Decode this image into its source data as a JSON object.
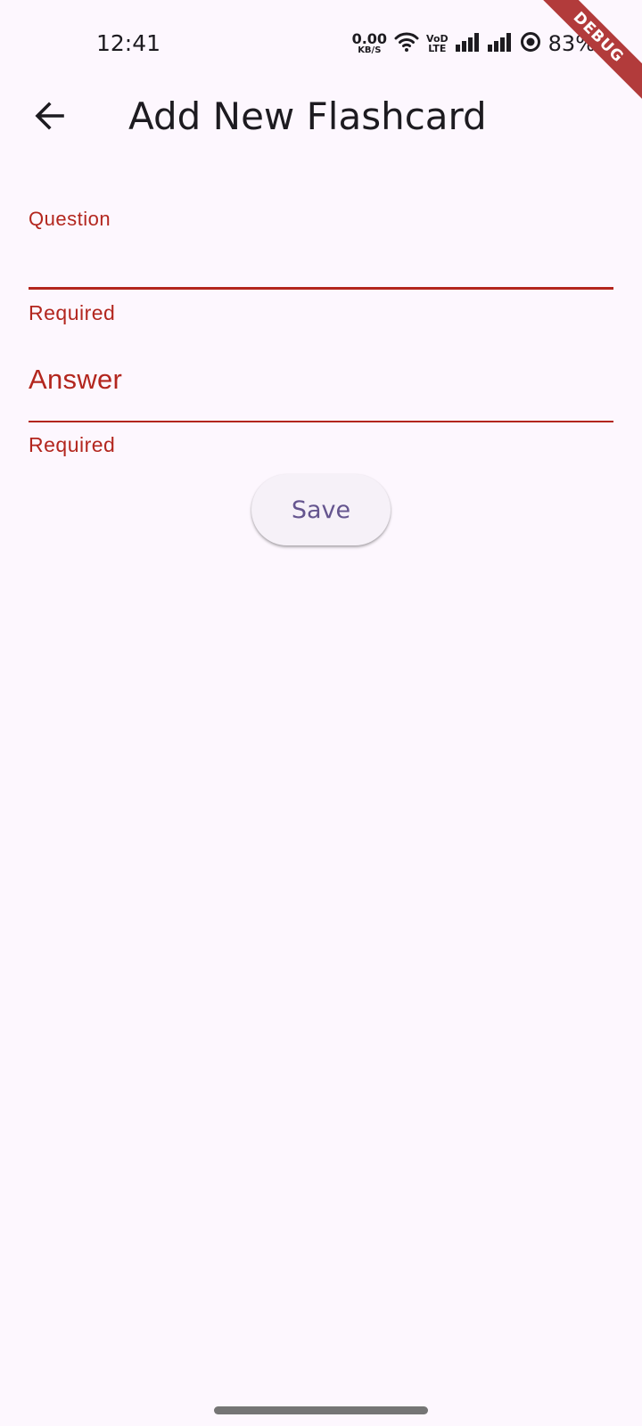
{
  "status_bar": {
    "time": "12:41",
    "net_speed_value": "0.00",
    "net_speed_unit": "KB/S",
    "volte_top": "VoD",
    "volte_bottom": "LTE",
    "battery_percent": "83%",
    "icons": [
      "wifi-icon",
      "signal-icon",
      "signal-icon",
      "battery-saver-icon"
    ]
  },
  "debug_banner": "DEBUG",
  "app_bar": {
    "title": "Add New Flashcard",
    "back_icon": "arrow-back-icon"
  },
  "form": {
    "question": {
      "label": "Question",
      "value": "",
      "error": "Required"
    },
    "answer": {
      "label": "Answer",
      "value": "",
      "error": "Required"
    },
    "save_label": "Save"
  },
  "colors": {
    "background": "#fdf7fe",
    "error": "#b3261e",
    "primary": "#65558f",
    "button_surface": "#f6f1f8",
    "debug_banner": "#b23b3b"
  }
}
